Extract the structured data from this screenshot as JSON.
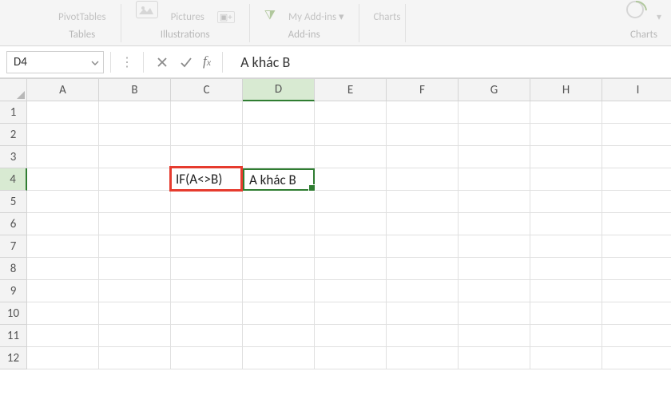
{
  "ribbon": {
    "groups": [
      {
        "top_item": "PivotTables",
        "label": "Tables"
      },
      {
        "top_item": "Pictures",
        "label": "Illustrations"
      },
      {
        "top_item": "My Add-ins ▾",
        "label": "Add-ins"
      },
      {
        "top_item": "Charts",
        "label": "Charts"
      }
    ]
  },
  "namebox": "D4",
  "formula_bar_value": "A khác B",
  "columns": [
    "A",
    "B",
    "C",
    "D",
    "E",
    "F",
    "G",
    "H",
    "I"
  ],
  "rows": [
    "1",
    "2",
    "3",
    "4",
    "5",
    "6",
    "7",
    "8",
    "9",
    "10",
    "11",
    "12"
  ],
  "active_column_index": 3,
  "active_row_index": 3,
  "cells": {
    "C4": "IF(A<>B)",
    "D4": "A khác B"
  }
}
